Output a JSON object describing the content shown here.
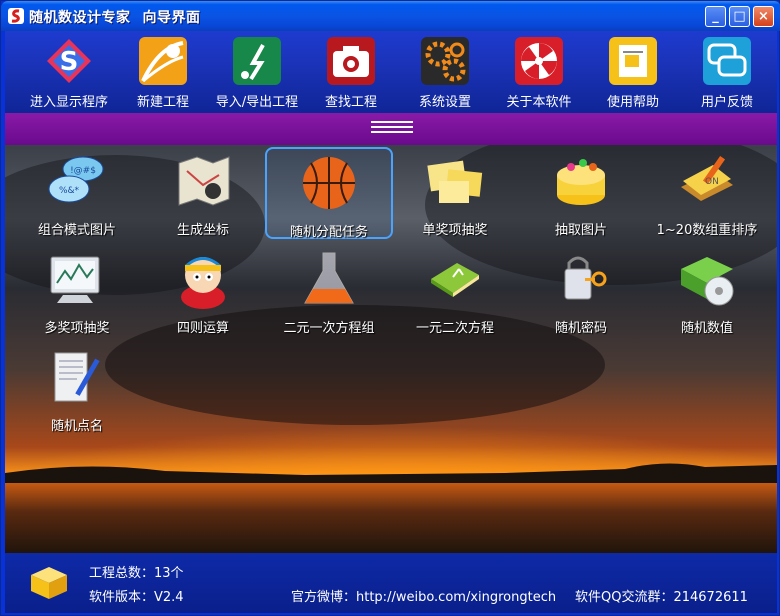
{
  "window": {
    "title_app": "随机数设计专家",
    "title_page": "向导界面",
    "min_label": "_",
    "max_label": "□",
    "close_label": "×"
  },
  "toolbar": {
    "items": [
      {
        "label": "进入显示程序",
        "icon": "s-logo-icon"
      },
      {
        "label": "新建工程",
        "icon": "new-project-icon"
      },
      {
        "label": "导入/导出工程",
        "icon": "import-export-icon"
      },
      {
        "label": "查找工程",
        "icon": "camera-search-icon"
      },
      {
        "label": "系统设置",
        "icon": "gears-icon"
      },
      {
        "label": "关于本软件",
        "icon": "pinwheel-icon"
      },
      {
        "label": "使用帮助",
        "icon": "help-icon"
      },
      {
        "label": "用户反馈",
        "icon": "chat-bubbles-icon"
      }
    ]
  },
  "apps": [
    {
      "label": "组合模式图片",
      "icon": "speech-bubbles-icon"
    },
    {
      "label": "生成坐标",
      "icon": "map-compass-icon"
    },
    {
      "label": "随机分配任务",
      "icon": "basketball-icon",
      "selected": true
    },
    {
      "label": "单奖项抽奖",
      "icon": "sticky-notes-icon"
    },
    {
      "label": "抽取图片",
      "icon": "cake-icon"
    },
    {
      "label": "1~20数组重排序",
      "icon": "notebook-pencil-icon"
    },
    {
      "label": "多奖项抽奖",
      "icon": "monitor-chart-icon"
    },
    {
      "label": "四则运算",
      "icon": "cartoon-character-icon"
    },
    {
      "label": "二元一次方程组",
      "icon": "flask-icon"
    },
    {
      "label": "一元二次方程",
      "icon": "green-book-icon"
    },
    {
      "label": "随机密码",
      "icon": "lock-key-icon"
    },
    {
      "label": "随机数值",
      "icon": "cd-folder-icon"
    },
    {
      "label": "随机点名",
      "icon": "paper-pen-icon"
    }
  ],
  "status": {
    "project_count": "工程总数：13个",
    "version": "软件版本：V2.4",
    "weibo": "官方微博：http://weibo.com/xingrongtech",
    "qq_group": "软件QQ交流群：214672611"
  },
  "colors": {
    "accent": "#0831d9",
    "strip": "#7a129a",
    "selection": "#4aa3ff"
  }
}
